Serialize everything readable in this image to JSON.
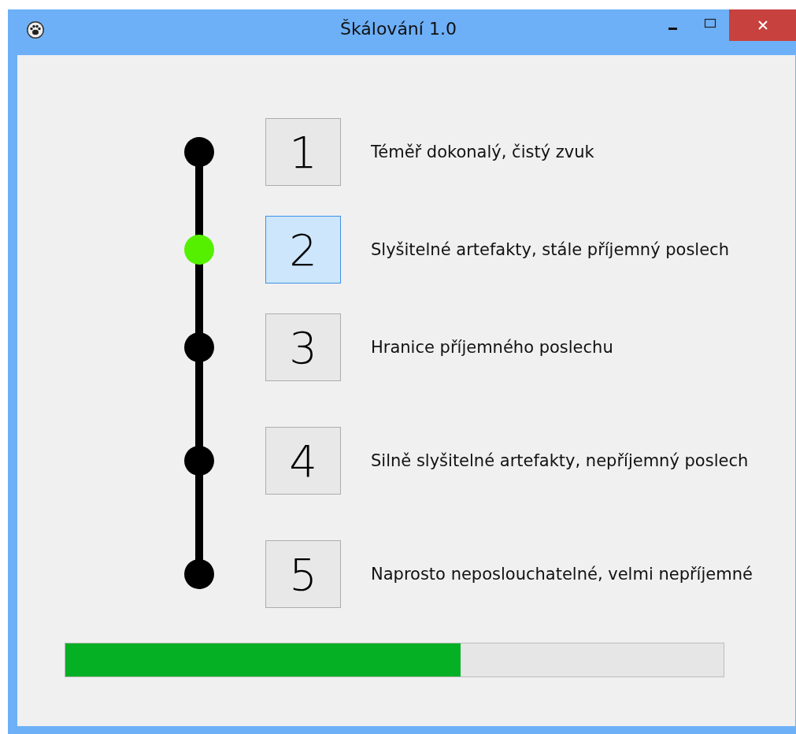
{
  "window": {
    "title": "Škálování 1.0"
  },
  "scale": [
    {
      "number": "1",
      "description": "Téměř dokonalý, čistý zvuk",
      "selected": false
    },
    {
      "number": "2",
      "description": "Slyšitelné artefakty, stále příjemný poslech",
      "selected": true
    },
    {
      "number": "3",
      "description": "Hranice příjemného poslechu",
      "selected": false
    },
    {
      "number": "4",
      "description": "Silně slyšitelné artefakty, nepříjemný poslech",
      "selected": false
    },
    {
      "number": "5",
      "description": "Naprosto neposlouchatelné, velmi nepříjemné",
      "selected": false
    }
  ],
  "progress": {
    "level": 0.6
  }
}
